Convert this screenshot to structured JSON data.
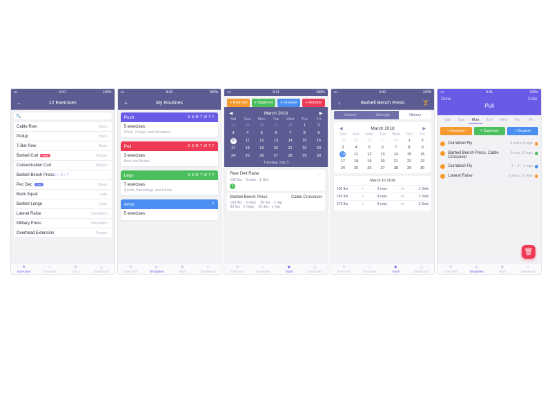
{
  "status": {
    "time": "9:41",
    "batt": "100%"
  },
  "nav": {
    "exercises": "Exercises",
    "templates": "Templates",
    "track": "Track",
    "dashboard": "Dashboard"
  },
  "s1": {
    "title": "12 Exercises",
    "search_ph": "Q",
    "rows": [
      {
        "n": "Cable Row",
        "m": "Back"
      },
      {
        "n": "Pullup",
        "m": "Back"
      },
      {
        "n": "T-Bar Row",
        "m": "Back"
      },
      {
        "n": "Barbell Curl",
        "m": "Biceps",
        "pill": "New",
        "pillc": "red"
      },
      {
        "n": "Concentration Curl",
        "m": "Biceps"
      },
      {
        "n": "Barbell Bench Press",
        "m": "",
        "tag": "C + S + T"
      },
      {
        "n": "Pec Dec",
        "m": "Chest",
        "pill": "Fav",
        "pillc": "blue"
      },
      {
        "n": "Back Squat",
        "m": "Legs"
      },
      {
        "n": "Barbell Lunge",
        "m": "Legs"
      },
      {
        "n": "Lateral Raise",
        "m": "Shoulders"
      },
      {
        "n": "Military Press",
        "m": "Shoulders"
      },
      {
        "n": "Overhead Extension",
        "m": "Triceps"
      }
    ]
  },
  "s2": {
    "title": "My Routines",
    "cards": [
      {
        "name": "Push",
        "days": "S S M T W T F",
        "color": "#6a5be6",
        "line1": "5 exercises",
        "line2": "Chest, Triceps, and Shoulders"
      },
      {
        "name": "Pull",
        "days": "S S M T W T F",
        "color": "#ef3a55",
        "line1": "3 exercises",
        "line2": "Back and Biceps"
      },
      {
        "name": "Legs",
        "days": "S S M T W T F",
        "color": "#4bbf5d",
        "line1": "7 exercises",
        "line2": "Quads, Hamstrings, and Glutes"
      },
      {
        "name": "Arms",
        "days": "           F",
        "color": "#4a8ef2",
        "line1": "5 exercises",
        "line2": ""
      }
    ]
  },
  "s3": {
    "btns": {
      "ex": "+ Exercise",
      "ss": "+ Superset",
      "dr": "+ Dropset",
      "rt": "+ Routine"
    },
    "month": "March 2018",
    "dow": [
      "Sat",
      "Sun",
      "Mon",
      "Tue",
      "Wed",
      "Thu",
      "Fri"
    ],
    "days": [
      [
        "24",
        "25",
        "26",
        "27",
        "28",
        "1",
        "2"
      ],
      [
        "3",
        "4",
        "5",
        "6",
        "7",
        "8",
        "9"
      ],
      [
        "10",
        "11",
        "12",
        "13",
        "14",
        "15",
        "16"
      ],
      [
        "17",
        "18",
        "19",
        "20",
        "21",
        "22",
        "23"
      ],
      [
        "24",
        "25",
        "26",
        "27",
        "28",
        "29",
        "30"
      ]
    ],
    "sel": "10",
    "datebar": "Tuesday July 3",
    "w1": {
      "name": "Rear Delt Raise",
      "info": "100 lbs · 3 reps · 1 Set"
    },
    "w2": {
      "name": "Barbell Bench Press",
      "side": "Cable Crossover",
      "l1": "100 lbs · 3 reps",
      "r1": "20 lbs · 1 rep",
      "l2": "60 lbs · 2 reps",
      "r2": "10 lbs · 1 rep"
    }
  },
  "s4": {
    "title": "Barbell Bench Press",
    "seg": {
      "a": "Volume",
      "b": "Strength",
      "c": "History"
    },
    "hist_date": "March 10 2018",
    "rows": [
      {
        "w": "100 lbs",
        "r": "3 reps",
        "s": "1 Sets"
      },
      {
        "w": "250 lbs",
        "r": "4 reps",
        "s": "2 Sets"
      },
      {
        "w": "275 lbs",
        "r": "3 reps",
        "s": "2 Sets"
      }
    ]
  },
  "s5": {
    "done": "Done",
    "color": "Color",
    "title": "Pull",
    "btns": {
      "ex": "+ Exercise",
      "ss": "+ Superset",
      "dr": "+ Dropset"
    },
    "dow": [
      "Sat",
      "Sun",
      "Mon",
      "Tue",
      "Wed",
      "Thu",
      "Fri"
    ],
    "sel_day": "Mon",
    "rows": [
      {
        "c": "o",
        "n": "Dumbbell Fly",
        "info": "5 sets x 5 reps",
        "dot": "o"
      },
      {
        "c": "o",
        "n": "Barbell Bench Press, Cable Crossover",
        "info": "8 reps\n10 reps",
        "dot": "g"
      },
      {
        "c": "o",
        "n": "Dumbbell Fly",
        "info": "5 – 2 – 1 reps",
        "dot": "b"
      },
      {
        "c": "o",
        "n": "Lateral Raise",
        "info": "2 sets x 10 reps",
        "dot": "o"
      }
    ]
  }
}
